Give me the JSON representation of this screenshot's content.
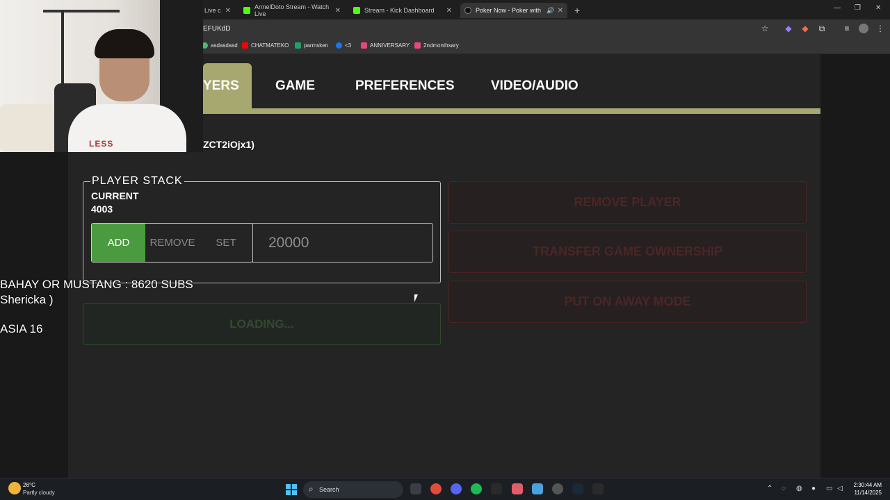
{
  "browser": {
    "tabs": [
      {
        "label": "Live c",
        "active": false
      },
      {
        "label": "ArmelDoto Stream - Watch Live",
        "active": false
      },
      {
        "label": "Stream - Kick Dashboard",
        "active": false
      },
      {
        "label": "Poker Now - Poker with Frie",
        "active": true
      }
    ],
    "new_tab_symbol": "+",
    "url": "EFUKdD",
    "bookmarks": [
      "asdasdasd",
      "CHATMATEKO",
      "parmsken",
      "<3",
      "ANNIVERSARY",
      "2ndmonthsary"
    ]
  },
  "settings": {
    "tabs": [
      {
        "label": "YERS",
        "active": true
      },
      {
        "label": "GAME",
        "active": false
      },
      {
        "label": "PREFERENCES",
        "active": false
      },
      {
        "label": "VIDEO/AUDIO",
        "active": false
      }
    ],
    "game_id_text": "ZCT2iOjx1)",
    "player_stack": {
      "legend": "PLAYER STACK",
      "current_label": "CURRENT",
      "current_value": "4003",
      "buttons": {
        "add": "ADD",
        "remove": "REMOVE",
        "set": "SET"
      },
      "selected": "add",
      "amount_value": "20000"
    },
    "loading_label": "LOADING...",
    "actions": {
      "remove_player": "REMOVE PLAYER",
      "transfer_ownership": "TRANSFER GAME OWNERSHIP",
      "away_mode": "PUT ON AWAY MODE"
    }
  },
  "overlay": {
    "line1": "BAHAY OR MUSTANG : 8620 SUBS",
    "line2": "Shericka )",
    "line3": "ASIA 16",
    "webcam_shirt_text": "LESS"
  },
  "taskbar": {
    "weather_temp": "26°C",
    "weather_desc": "Partly cloudy",
    "search_label": "Search",
    "time": "2:30:44 AM",
    "date": "11/14/2025"
  },
  "colors": {
    "accent_olive": "#a6a86f",
    "add_green": "#4a9a3f",
    "danger_red": "#4c2525"
  }
}
